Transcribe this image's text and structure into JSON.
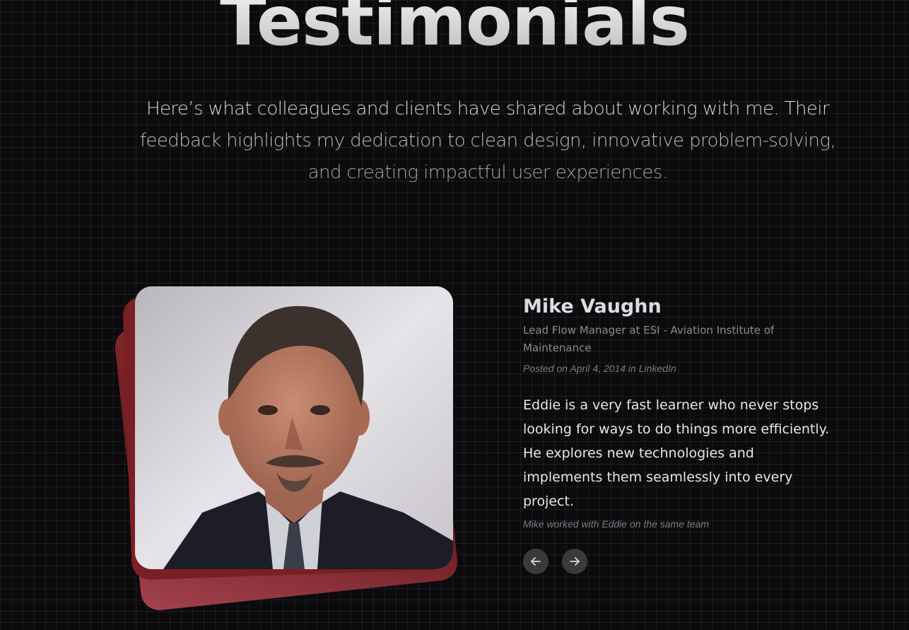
{
  "section": {
    "title": "Testimonials",
    "intro": "Here’s what colleagues and clients have shared about working with me. Their feedback highlights my dedication to clean design, innovative problem-solving, and creating impactful user experiences."
  },
  "testimonial": {
    "name": "Mike Vaughn",
    "role": "Lead Flow Manager at ESI - Aviation Institute of Maintenance",
    "posted": "Posted on April 4, 2014 in LinkedIn",
    "quote": "Eddie is a very fast learner who never stops looking for ways to do things more efficiently. He explores new technologies and implements them seamlessly into every project.",
    "relation": "Mike worked with Eddie on the same team"
  },
  "navigation": {
    "prev_icon": "arrow-left-icon",
    "next_icon": "arrow-right-icon"
  },
  "colors": {
    "background": "#0b0b0e",
    "card_accent": "#7a1f24",
    "nav_button": "#3a3a3d"
  }
}
